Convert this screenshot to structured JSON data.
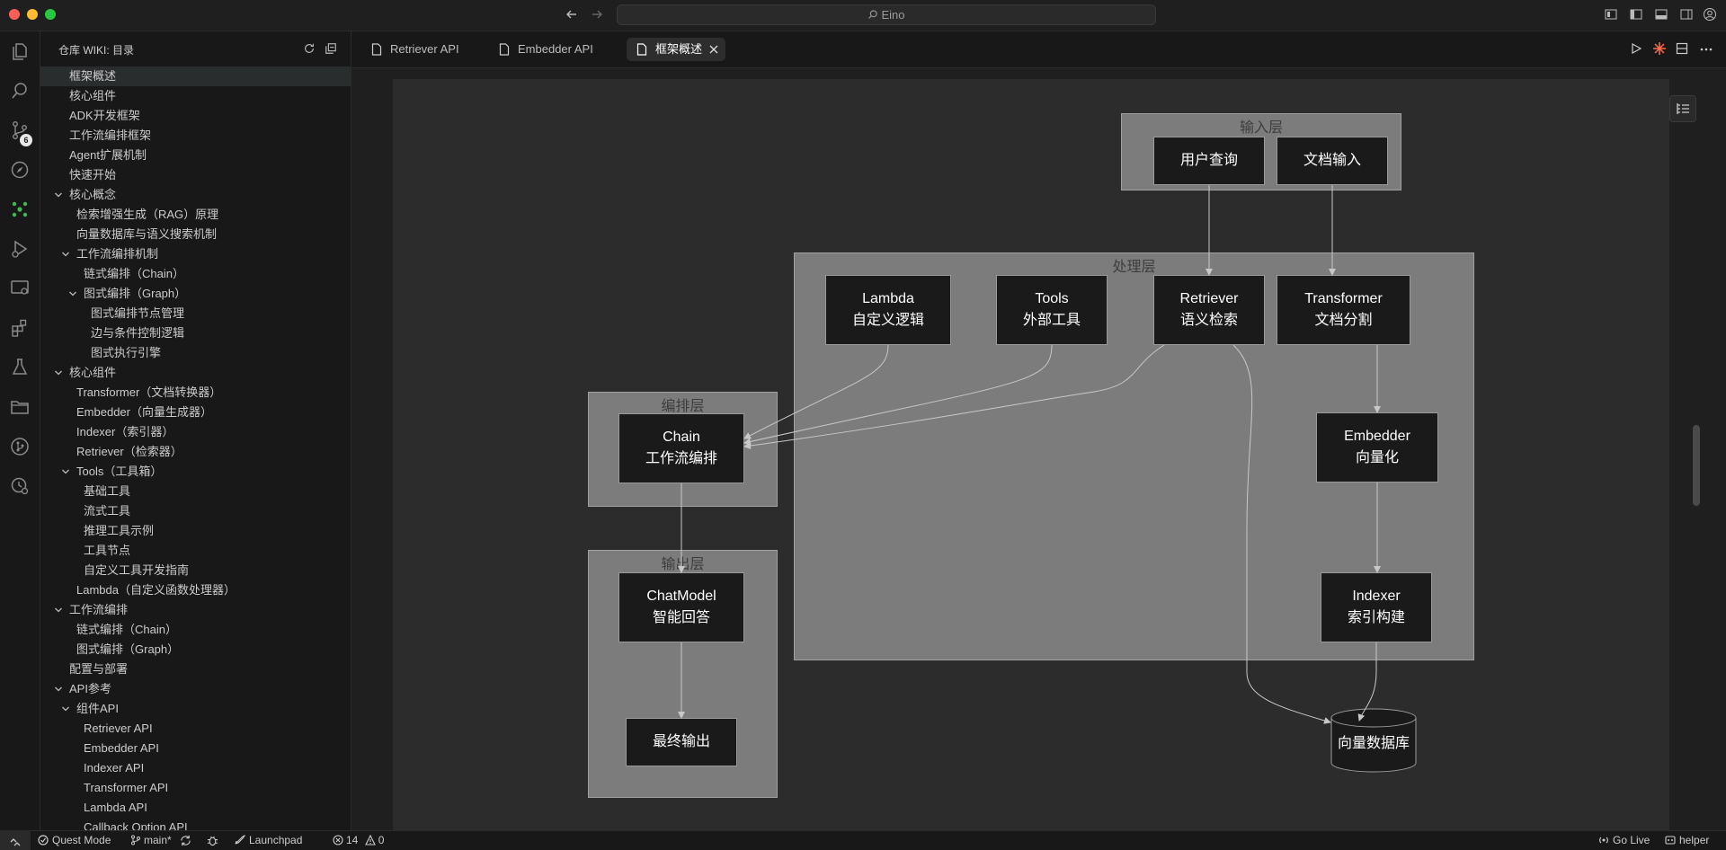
{
  "window": {
    "title": "Eino"
  },
  "sidebar": {
    "title": "仓库 WIKI: 目录",
    "items": [
      {
        "label": "框架概述",
        "level": 0,
        "arrow": false
      },
      {
        "label": "核心组件",
        "level": 0,
        "arrow": false
      },
      {
        "label": "ADK开发框架",
        "level": 0,
        "arrow": false
      },
      {
        "label": "工作流编排框架",
        "level": 0,
        "arrow": false
      },
      {
        "label": "Agent扩展机制",
        "level": 0,
        "arrow": false
      },
      {
        "label": "快速开始",
        "level": 0,
        "arrow": false
      },
      {
        "label": "核心概念",
        "level": 0,
        "arrow": true
      },
      {
        "label": "检索增强生成（RAG）原理",
        "level": 1,
        "arrow": false
      },
      {
        "label": "向量数据库与语义搜索机制",
        "level": 1,
        "arrow": false
      },
      {
        "label": "工作流编排机制",
        "level": 1,
        "arrow": true
      },
      {
        "label": "链式编排（Chain）",
        "level": 2,
        "arrow": false
      },
      {
        "label": "图式编排（Graph）",
        "level": 2,
        "arrow": true
      },
      {
        "label": "图式编排节点管理",
        "level": 3,
        "arrow": false
      },
      {
        "label": "边与条件控制逻辑",
        "level": 3,
        "arrow": false
      },
      {
        "label": "图式执行引擎",
        "level": 3,
        "arrow": false
      },
      {
        "label": "核心组件",
        "level": 0,
        "arrow": true
      },
      {
        "label": "Transformer（文档转换器）",
        "level": 1,
        "arrow": false
      },
      {
        "label": "Embedder（向量生成器）",
        "level": 1,
        "arrow": false
      },
      {
        "label": "Indexer（索引器）",
        "level": 1,
        "arrow": false
      },
      {
        "label": "Retriever（检索器）",
        "level": 1,
        "arrow": false
      },
      {
        "label": "Tools（工具箱）",
        "level": 1,
        "arrow": true
      },
      {
        "label": "基础工具",
        "level": 2,
        "arrow": false
      },
      {
        "label": "流式工具",
        "level": 2,
        "arrow": false
      },
      {
        "label": "推理工具示例",
        "level": 2,
        "arrow": false
      },
      {
        "label": "工具节点",
        "level": 2,
        "arrow": false
      },
      {
        "label": "自定义工具开发指南",
        "level": 2,
        "arrow": false
      },
      {
        "label": "Lambda（自定义函数处理器）",
        "level": 1,
        "arrow": false
      },
      {
        "label": "工作流编排",
        "level": 0,
        "arrow": true
      },
      {
        "label": "链式编排（Chain）",
        "level": 1,
        "arrow": false
      },
      {
        "label": "图式编排（Graph）",
        "level": 1,
        "arrow": false
      },
      {
        "label": "配置与部署",
        "level": 0,
        "arrow": false
      },
      {
        "label": "API参考",
        "level": 0,
        "arrow": true
      },
      {
        "label": "组件API",
        "level": 1,
        "arrow": true
      },
      {
        "label": "Retriever API",
        "level": 2,
        "arrow": false
      },
      {
        "label": "Embedder API",
        "level": 2,
        "arrow": false
      },
      {
        "label": "Indexer API",
        "level": 2,
        "arrow": false
      },
      {
        "label": "Transformer API",
        "level": 2,
        "arrow": false
      },
      {
        "label": "Lambda API",
        "level": 2,
        "arrow": false
      },
      {
        "label": "Callback Option API",
        "level": 2,
        "arrow": false
      }
    ]
  },
  "tabs": [
    {
      "label": "Retriever API",
      "active": false
    },
    {
      "label": "Embedder API",
      "active": false
    },
    {
      "label": "框架概述",
      "active": true
    }
  ],
  "activity": {
    "scm_badge": "6"
  },
  "diagram": {
    "groups": {
      "input": "输入层",
      "process": "处理层",
      "orchestrate": "编排层",
      "output": "输出层"
    },
    "nodes": {
      "user_query": [
        "用户查询"
      ],
      "doc_input": [
        "文档输入"
      ],
      "lambda": [
        "Lambda",
        "自定义逻辑"
      ],
      "tools": [
        "Tools",
        "外部工具"
      ],
      "retriever": [
        "Retriever",
        "语义检索"
      ],
      "transformer": [
        "Transformer",
        "文档分割"
      ],
      "embedder": [
        "Embedder",
        "向量化"
      ],
      "indexer": [
        "Indexer",
        "索引构建"
      ],
      "chain": [
        "Chain",
        "工作流编排"
      ],
      "chatmodel": [
        "ChatModel",
        "智能回答"
      ],
      "final_output": [
        "最终输出"
      ],
      "vector_db": [
        "向量数据库"
      ]
    }
  },
  "statusbar": {
    "quest_mode": "Quest Mode",
    "branch": "main*",
    "launchpad": "Launchpad",
    "errors": "14",
    "warnings": "0",
    "go_live": "Go Live",
    "helper": "helper"
  }
}
